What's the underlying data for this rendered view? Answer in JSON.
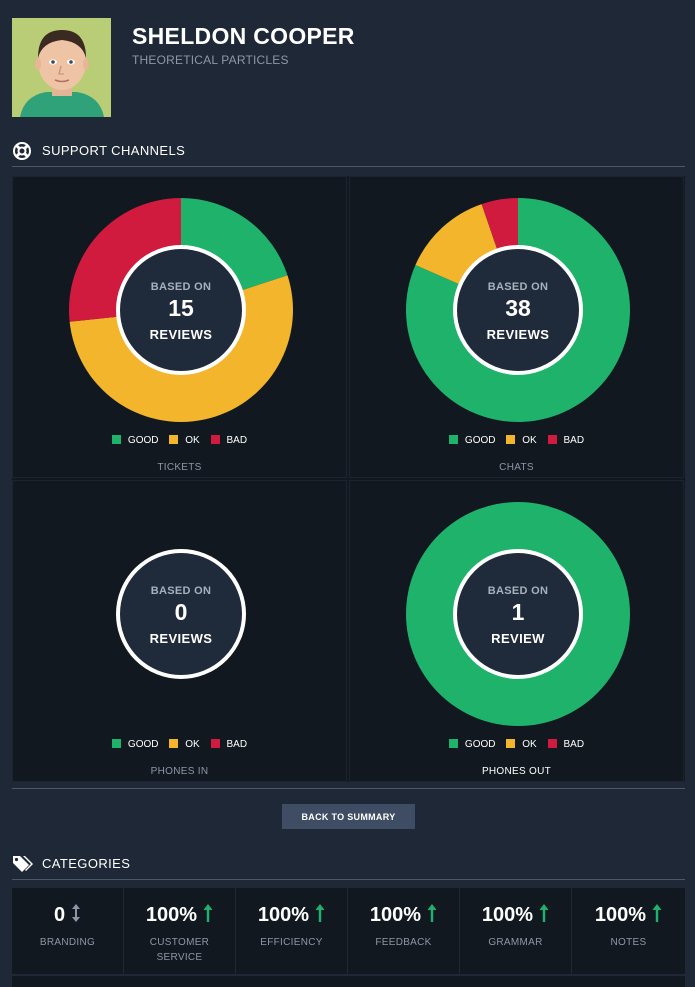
{
  "profile": {
    "name": "SHELDON COOPER",
    "team": "THEORETICAL PARTICLES"
  },
  "support_channels": {
    "title": "SUPPORT CHANNELS",
    "icon": "lifebuoy-icon",
    "legend": [
      "GOOD",
      "OK",
      "BAD"
    ],
    "colors": {
      "good": "#1fb26b",
      "ok": "#f2b52c",
      "bad": "#d01b3f"
    },
    "channels": [
      {
        "label": "TICKETS",
        "based_on": "BASED ON",
        "count": "15",
        "unit": "REVIEWS",
        "good": 3,
        "ok": 8,
        "bad": 4
      },
      {
        "label": "CHATS",
        "based_on": "BASED ON",
        "count": "38",
        "unit": "REVIEWS",
        "good": 31,
        "ok": 5,
        "bad": 2
      },
      {
        "label": "PHONES IN",
        "based_on": "BASED ON",
        "count": "0",
        "unit": "REVIEWS",
        "good": 0,
        "ok": 0,
        "bad": 0
      },
      {
        "label": "PHONES OUT",
        "based_on": "BASED ON",
        "count": "1",
        "unit": "REVIEW",
        "good": 1,
        "ok": 0,
        "bad": 0
      }
    ]
  },
  "back_button": {
    "label": "BACK TO SUMMARY"
  },
  "categories": {
    "title": "CATEGORIES",
    "icon": "tags-icon",
    "items": [
      {
        "value": "0",
        "label": "BRANDING",
        "trend": "neutral"
      },
      {
        "value": "100%",
        "label": "CUSTOMER SERVICE",
        "trend": "up"
      },
      {
        "value": "100%",
        "label": "EFFICIENCY",
        "trend": "up"
      },
      {
        "value": "100%",
        "label": "FEEDBACK",
        "trend": "up"
      },
      {
        "value": "100%",
        "label": "GRAMMAR",
        "trend": "up"
      },
      {
        "value": "100%",
        "label": "NOTES",
        "trend": "up"
      }
    ],
    "trend_colors": {
      "up": "#1fb26b",
      "neutral": "#8d97a6"
    }
  }
}
